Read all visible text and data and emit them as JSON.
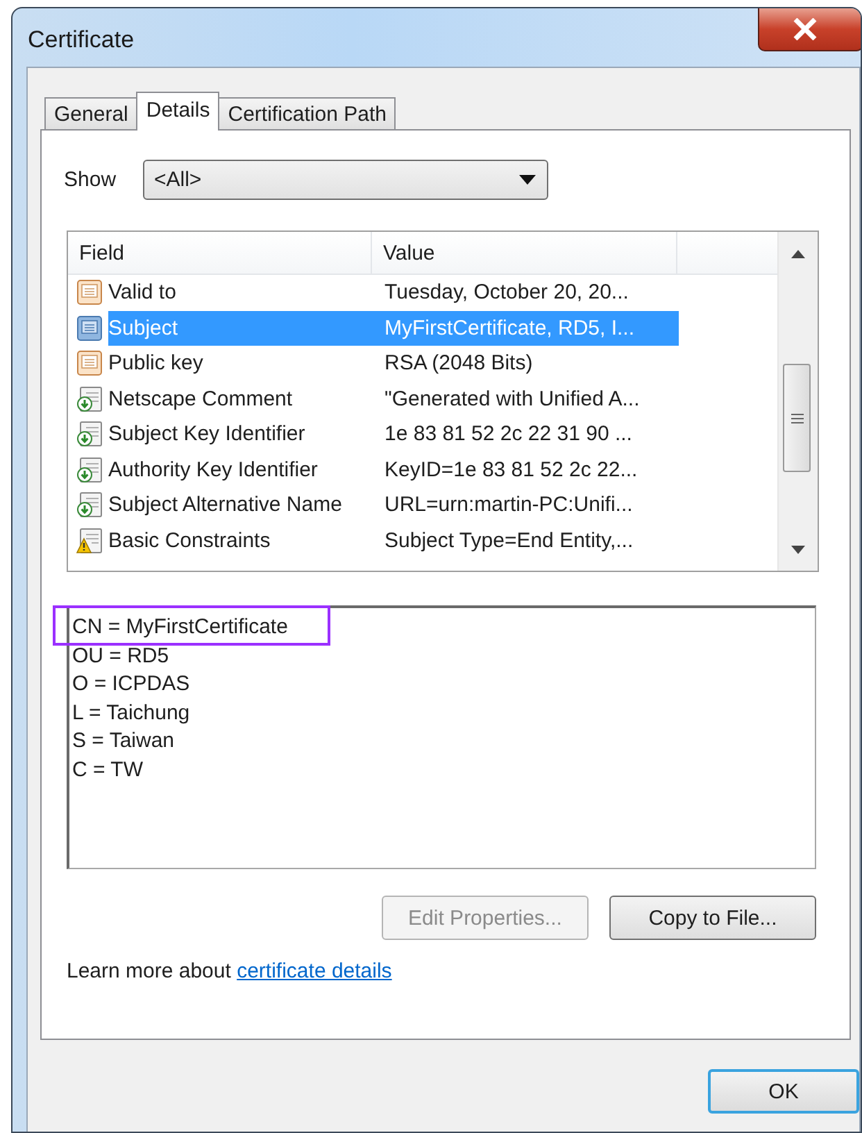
{
  "window": {
    "title": "Certificate"
  },
  "tabs": [
    {
      "label": "General",
      "selected": false
    },
    {
      "label": "Details",
      "selected": true
    },
    {
      "label": "Certification Path",
      "selected": false
    }
  ],
  "show": {
    "label": "Show",
    "value": "<All>"
  },
  "table": {
    "columns": [
      "Field",
      "Value"
    ],
    "rows": [
      {
        "field": "Valid to",
        "value": "Tuesday, October 20, 20...",
        "kind": "document",
        "selected": false
      },
      {
        "field": "Subject",
        "value": "MyFirstCertificate, RD5, I...",
        "kind": "document",
        "selected": true
      },
      {
        "field": "Public key",
        "value": "RSA (2048 Bits)",
        "kind": "document",
        "selected": false
      },
      {
        "field": "Netscape Comment",
        "value": "\"Generated with Unified A...",
        "kind": "extension",
        "selected": false
      },
      {
        "field": "Subject Key Identifier",
        "value": "1e 83 81 52 2c 22 31 90 ...",
        "kind": "extension",
        "selected": false
      },
      {
        "field": "Authority Key Identifier",
        "value": "KeyID=1e 83 81 52 2c 22...",
        "kind": "extension",
        "selected": false
      },
      {
        "field": "Subject Alternative Name",
        "value": "URL=urn:martin-PC:Unifi...",
        "kind": "extension",
        "selected": false
      },
      {
        "field": "Basic Constraints",
        "value": "Subject Type=End Entity,...",
        "kind": "warning",
        "selected": false
      }
    ]
  },
  "details": {
    "lines": [
      {
        "text": "CN = MyFirstCertificate",
        "highlighted": true
      },
      {
        "text": "OU = RD5",
        "highlighted": false
      },
      {
        "text": "O = ICPDAS",
        "highlighted": false
      },
      {
        "text": "L = Taichung",
        "highlighted": false
      },
      {
        "text": "S = Taiwan",
        "highlighted": false
      },
      {
        "text": "C = TW",
        "highlighted": false
      }
    ]
  },
  "buttons": [
    {
      "label": "Edit Properties...",
      "disabled": true
    },
    {
      "label": "Copy to File...",
      "disabled": false
    }
  ],
  "learn_more": {
    "text": "Learn more about",
    "link": "certificate details"
  },
  "ok_button": {
    "label": "OK"
  }
}
